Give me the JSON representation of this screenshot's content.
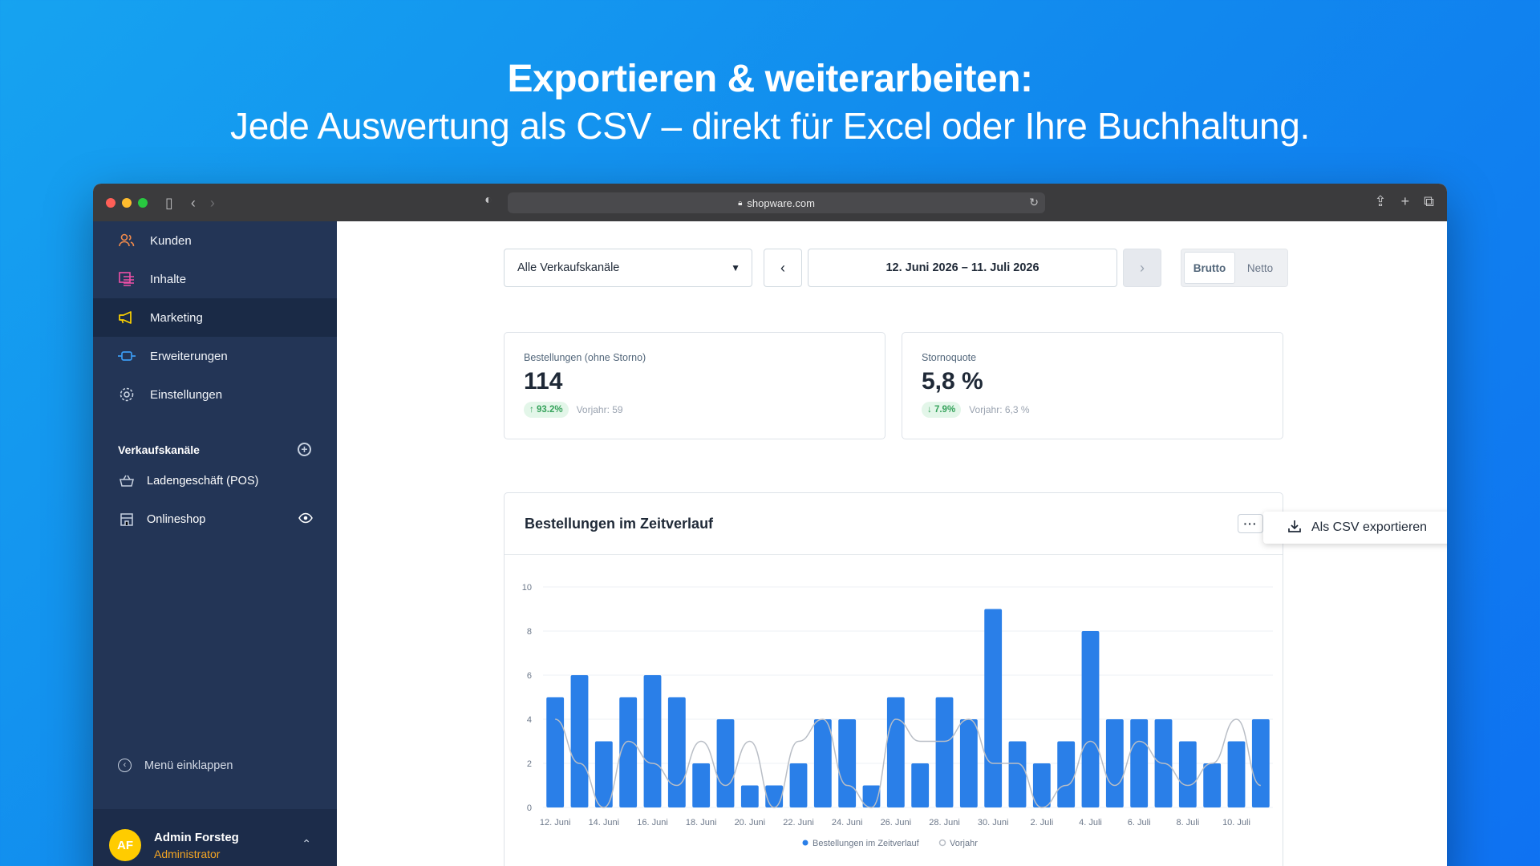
{
  "hero": {
    "title": "Exportieren & weiterarbeiten:",
    "subtitle": "Jede Auswertung als CSV – direkt für Excel oder Ihre Buchhaltung."
  },
  "browser": {
    "url": "shopware.com"
  },
  "sidebar": {
    "items": [
      {
        "label": "Kunden",
        "icon": "users-icon"
      },
      {
        "label": "Inhalte",
        "icon": "content-icon"
      },
      {
        "label": "Marketing",
        "icon": "megaphone-icon"
      },
      {
        "label": "Erweiterungen",
        "icon": "plug-icon"
      },
      {
        "label": "Einstellungen",
        "icon": "gear-icon"
      }
    ],
    "sales_channels_title": "Verkaufskanäle",
    "channels": [
      {
        "label": "Ladengeschäft (POS)",
        "icon": "basket-icon"
      },
      {
        "label": "Onlineshop",
        "icon": "storefront-icon"
      }
    ],
    "collapse_label": "Menü einklappen",
    "user": {
      "initials": "AF",
      "name": "Admin Forsteg",
      "role": "Administrator"
    }
  },
  "filters": {
    "channel_select": "Alle Verkaufskanäle",
    "date_range": "12. Juni 2026 – 11. Juli 2026",
    "toggle_gross": "Brutto",
    "toggle_net": "Netto"
  },
  "kpis": [
    {
      "label": "Bestellungen (ohne Storno)",
      "value": "114",
      "change": "93.2%",
      "direction": "up",
      "previous": "Vorjahr: 59"
    },
    {
      "label": "Stornoquote",
      "value": "5,8 %",
      "change": "7.9%",
      "direction": "down",
      "previous": "Vorjahr: 6,3 %"
    }
  ],
  "chart_card": {
    "title": "Bestellungen im Zeitverlauf",
    "menu_button": "···",
    "export_label": "Als CSV exportieren"
  },
  "chart_data": {
    "type": "bar",
    "ylim": [
      0,
      10
    ],
    "yticks": [
      0,
      2,
      4,
      6,
      8,
      10
    ],
    "x_tick_labels": [
      "12. Juni",
      "14. Juni",
      "16. Juni",
      "18. Juni",
      "20. Juni",
      "22. Juni",
      "24. Juni",
      "26. Juni",
      "28. Juni",
      "30. Juni",
      "2. Juli",
      "4. Juli",
      "6. Juli",
      "8. Juli",
      "10. Juli"
    ],
    "series": [
      {
        "name": "Bestellungen im Zeitverlauf",
        "type": "bar",
        "color": "#2a7fe8",
        "values": [
          5,
          6,
          3,
          5,
          6,
          5,
          2,
          4,
          1,
          1,
          2,
          4,
          4,
          1,
          5,
          2,
          5,
          4,
          9,
          3,
          2,
          3,
          8,
          4,
          4,
          4,
          3,
          2,
          3,
          4
        ]
      },
      {
        "name": "Vorjahr",
        "type": "line",
        "color": "#b9bec6",
        "values": [
          4,
          2,
          0,
          3,
          2,
          1,
          3,
          1,
          3,
          0,
          3,
          4,
          1,
          0,
          4,
          3,
          3,
          4,
          2,
          2,
          0,
          1,
          3,
          1,
          3,
          2,
          1,
          2,
          4,
          1
        ]
      }
    ],
    "legend": [
      "Bestellungen im Zeitverlauf",
      "Vorjahr"
    ],
    "legend_position": "bottom-center"
  }
}
